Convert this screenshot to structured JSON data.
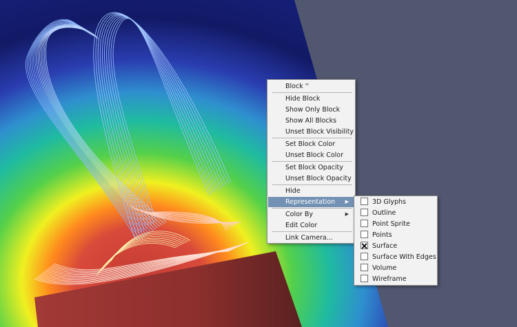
{
  "context_menu": {
    "block_title": "Block ''",
    "hide_block": "Hide Block",
    "show_only_block": "Show Only Block",
    "show_all_blocks": "Show All Blocks",
    "unset_block_visibility": "Unset Block Visibility",
    "set_block_color": "Set Block Color",
    "unset_block_color": "Unset Block Color",
    "set_block_opacity": "Set Block Opacity",
    "unset_block_opacity": "Unset Block Opacity",
    "hide": "Hide",
    "representation": "Representation",
    "color_by": "Color By",
    "edit_color": "Edit Color",
    "link_camera": "Link Camera..."
  },
  "representation_submenu": {
    "glyphs": "3D Glyphs",
    "outline": "Outline",
    "point_sprite": "Point Sprite",
    "points": "Points",
    "surface": "Surface",
    "surface_with_edges": "Surface With Edges",
    "volume": "Volume",
    "wireframe": "Wireframe",
    "checked_item": "Surface",
    "check_mark": "🗙"
  },
  "colors": {
    "background": "#525770",
    "menu_highlight": "#7291b3",
    "menu_background": "#f2f2f2"
  }
}
